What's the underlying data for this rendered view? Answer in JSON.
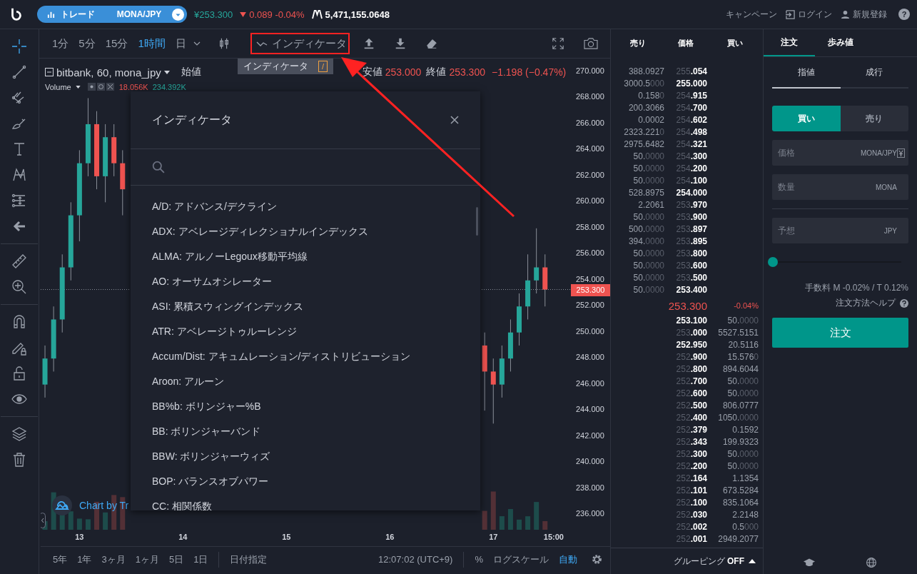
{
  "topbar": {
    "mode": "トレード",
    "pair": "MONA/JPY",
    "price": "¥253.300",
    "change": "0.089 -0.04%",
    "volume": "5,471,155.0648",
    "links": [
      {
        "kind": "text",
        "label": "キャンペーン"
      },
      {
        "kind": "login",
        "label": "ログイン"
      },
      {
        "kind": "user",
        "label": "新規登録"
      },
      {
        "kind": "help",
        "label": "?"
      }
    ]
  },
  "tool_groups": [
    [
      {
        "kind": "crosshair",
        "selected": true
      },
      {
        "kind": "line",
        "selected": false
      },
      {
        "kind": "fork",
        "selected": false
      },
      {
        "kind": "brush",
        "selected": false
      },
      {
        "kind": "text",
        "selected": false
      },
      {
        "kind": "pattern",
        "selected": false
      },
      {
        "kind": "measure",
        "selected": false
      },
      {
        "kind": "back",
        "selected": false
      }
    ],
    [
      {
        "kind": "ruler",
        "selected": false
      },
      {
        "kind": "zoom",
        "selected": false
      }
    ],
    [
      {
        "kind": "magnet",
        "selected": false
      },
      {
        "kind": "pencil-lock",
        "selected": false
      },
      {
        "kind": "lock",
        "selected": false
      },
      {
        "kind": "eye",
        "selected": false
      }
    ],
    [
      {
        "kind": "layers",
        "selected": false
      },
      {
        "kind": "trash",
        "selected": false
      }
    ]
  ],
  "toolbar": {
    "intervals": [
      {
        "label": "1分",
        "selected": false
      },
      {
        "label": "5分",
        "selected": false
      },
      {
        "label": "15分",
        "selected": false
      },
      {
        "label": "1時間",
        "selected": true
      },
      {
        "label": "日",
        "selected": false
      }
    ],
    "indicator_button": {
      "label": "インディケータ",
      "highlighted": true
    },
    "tooltip": {
      "label": "インディケータ",
      "key": "/"
    },
    "annotation_arrow": true
  },
  "legend": {
    "symbol": "bitbank, 60, mona_jpy",
    "ohlc": [
      {
        "label": "始値"
      },
      {
        "label": "安値",
        "value": "253.000"
      },
      {
        "label": "終値",
        "value": "253.300"
      }
    ],
    "change": "−1.198 (−0.47%)",
    "volume_label": "Volume",
    "volume_down": "18.056K",
    "volume_up": "234.392K",
    "attribution": "Chart by Tr"
  },
  "chart": {
    "last_price_tag": "253.300",
    "chart_data": {
      "type": "candlestick",
      "categories": [
        null,
        null,
        null,
        null,
        "13",
        null,
        null,
        null,
        null,
        null,
        null,
        null,
        null,
        null,
        null,
        null,
        "14",
        null,
        null,
        null,
        null,
        null,
        null,
        null,
        null,
        null,
        null,
        null,
        "15",
        null,
        null,
        null,
        null,
        null,
        null,
        null,
        null,
        null,
        null,
        null,
        "16",
        null,
        null,
        null,
        null,
        null,
        null,
        null,
        null,
        null,
        null,
        null,
        "17",
        null,
        null,
        null,
        null,
        null,
        null,
        "15:00"
      ],
      "ohlc": [
        [
          246,
          249,
          245,
          248
        ],
        [
          248,
          252,
          247,
          251
        ],
        [
          251,
          256,
          250,
          255
        ],
        [
          255,
          260,
          254,
          259
        ],
        [
          259,
          264,
          257,
          263
        ],
        [
          263,
          268,
          262,
          266
        ],
        [
          266,
          267,
          261,
          262
        ],
        [
          262,
          266,
          260,
          265
        ],
        [
          265,
          266,
          262,
          263
        ],
        [
          263,
          264,
          259,
          261
        ],
        null,
        null,
        null,
        null,
        null,
        null,
        null,
        null,
        null,
        null,
        null,
        null,
        null,
        null,
        null,
        null,
        null,
        null,
        null,
        null,
        null,
        null,
        null,
        null,
        null,
        null,
        null,
        null,
        null,
        null,
        null,
        null,
        null,
        null,
        null,
        null,
        null,
        null,
        null,
        null,
        null,
        [
          249,
          250,
          244,
          247
        ],
        [
          247,
          248,
          243,
          246
        ],
        [
          246,
          249,
          245,
          248
        ],
        [
          248,
          251,
          247,
          250
        ],
        [
          250,
          253,
          249,
          252
        ],
        [
          252,
          256,
          251,
          254
        ],
        [
          254,
          258,
          253,
          255
        ],
        [
          255,
          256,
          252,
          253.3
        ],
        null
      ],
      "ref_lines": [
        {
          "axis": "y",
          "value": 253.3
        }
      ],
      "ylim": [
        236,
        270
      ],
      "yticks": [
        {
          "value": 270,
          "label": "270.000"
        },
        {
          "value": 268,
          "label": "268.000"
        },
        {
          "value": 266,
          "label": "266.000"
        },
        {
          "value": 264,
          "label": "264.000"
        },
        {
          "value": 262,
          "label": "262.000"
        },
        {
          "value": 260,
          "label": "260.000"
        },
        {
          "value": 258,
          "label": "258.000"
        },
        {
          "value": 256,
          "label": "256.000"
        },
        {
          "value": 254,
          "label": "254.000"
        },
        {
          "value": 252,
          "label": "252.000"
        },
        {
          "value": 250,
          "label": "250.000"
        },
        {
          "value": 248,
          "label": "248.000"
        },
        {
          "value": 246,
          "label": "246.000"
        },
        {
          "value": 244,
          "label": "244.000"
        },
        {
          "value": 242,
          "label": "242.000"
        },
        {
          "value": 240,
          "label": "240.000"
        },
        {
          "value": 238,
          "label": "238.000"
        },
        {
          "value": 236,
          "label": "236.000"
        }
      ]
    }
  },
  "indicator_dialog": {
    "title": "インディケータ",
    "items": [
      "A/D: アドバンス/デクライン",
      "ADX: アベレージディレクショナルインデックス",
      "ALMA: アルノーLegoux移動平均線",
      "AO: オーサムオシレーター",
      "ASI: 累積スウィングインデックス",
      "ATR: アベレージトゥルーレンジ",
      "Accum/Dist: アキュムレーション/ディストリビューション",
      "Aroon: アルーン",
      "BB%b: ボリンジャー%B",
      "BB: ボリンジャーバンド",
      "BBW: ボリンジャーウィズ",
      "BOP: バランスオブパワー",
      "CC: 相関係数"
    ]
  },
  "bottom_bar": {
    "ranges": [
      "5年",
      "1年",
      "3ヶ月",
      "1ヶ月",
      "5日",
      "1日"
    ],
    "date_button": "日付指定",
    "clock": "12:07:02 (UTC+9)",
    "options": [
      {
        "label": "%",
        "selected": false
      },
      {
        "label": "ログスケール",
        "selected": false
      },
      {
        "label": "自動",
        "selected": true
      }
    ]
  },
  "orderbook": {
    "columns": [
      "売り",
      "価格",
      "買い"
    ],
    "asks": [
      {
        "amount": "388.0927",
        "price": "255.054",
        "emphasized": false
      },
      {
        "amount": "3000.5000",
        "price": "255.000",
        "emphasized": true
      },
      {
        "amount": "0.1580",
        "price": "254.915",
        "emphasized": false
      },
      {
        "amount": "200.3066",
        "price": "254.700",
        "emphasized": false
      },
      {
        "amount": "0.0002",
        "price": "254.602",
        "emphasized": false
      },
      {
        "amount": "2323.2210",
        "price": "254.498",
        "emphasized": false
      },
      {
        "amount": "2975.6482",
        "price": "254.321",
        "emphasized": false
      },
      {
        "amount": "50.0000",
        "price": "254.300",
        "emphasized": false
      },
      {
        "amount": "50.0000",
        "price": "254.200",
        "emphasized": false
      },
      {
        "amount": "50.0000",
        "price": "254.100",
        "emphasized": false
      },
      {
        "amount": "528.8975",
        "price": "254.000",
        "emphasized": true
      },
      {
        "amount": "2.2061",
        "price": "253.970",
        "emphasized": false
      },
      {
        "amount": "50.0000",
        "price": "253.900",
        "emphasized": false
      },
      {
        "amount": "500.0000",
        "price": "253.897",
        "emphasized": false
      },
      {
        "amount": "394.0000",
        "price": "253.895",
        "emphasized": false
      },
      {
        "amount": "50.0000",
        "price": "253.800",
        "emphasized": false
      },
      {
        "amount": "50.0000",
        "price": "253.600",
        "emphasized": false
      },
      {
        "amount": "50.0000",
        "price": "253.500",
        "emphasized": false
      },
      {
        "amount": "50.0000",
        "price": "253.400",
        "emphasized": true
      }
    ],
    "last": "253.300",
    "last_change": "-0.04%",
    "bids": [
      {
        "price": "253.100",
        "amount": "50.0000",
        "emphasized": true
      },
      {
        "price": "253.000",
        "amount": "5527.5151",
        "emphasized": false
      },
      {
        "price": "252.950",
        "amount": "20.5116",
        "emphasized": true
      },
      {
        "price": "252.900",
        "amount": "15.5760",
        "emphasized": false
      },
      {
        "price": "252.800",
        "amount": "894.6044",
        "emphasized": false
      },
      {
        "price": "252.700",
        "amount": "50.0000",
        "emphasized": false
      },
      {
        "price": "252.600",
        "amount": "50.0000",
        "emphasized": false
      },
      {
        "price": "252.500",
        "amount": "806.0777",
        "emphasized": false
      },
      {
        "price": "252.400",
        "amount": "1050.0000",
        "emphasized": false
      },
      {
        "price": "252.379",
        "amount": "0.1592",
        "emphasized": false
      },
      {
        "price": "252.343",
        "amount": "199.9323",
        "emphasized": false
      },
      {
        "price": "252.300",
        "amount": "50.0000",
        "emphasized": false
      },
      {
        "price": "252.200",
        "amount": "50.0000",
        "emphasized": false
      },
      {
        "price": "252.164",
        "amount": "1.1354",
        "emphasized": false
      },
      {
        "price": "252.101",
        "amount": "673.5284",
        "emphasized": false
      },
      {
        "price": "252.100",
        "amount": "835.1064",
        "emphasized": false
      },
      {
        "price": "252.030",
        "amount": "2.2148",
        "emphasized": false
      },
      {
        "price": "252.002",
        "amount": "0.5000",
        "emphasized": false
      },
      {
        "price": "252.001",
        "amount": "2949.2077",
        "emphasized": false
      }
    ],
    "grouping_label": "グルーピング",
    "grouping_value": "OFF"
  },
  "order_panel": {
    "tabs": [
      {
        "label": "注文",
        "selected": true
      },
      {
        "label": "歩み値",
        "selected": false
      }
    ],
    "order_types": [
      {
        "label": "指値",
        "selected": true
      },
      {
        "label": "成行",
        "selected": false
      }
    ],
    "sides": [
      {
        "label": "買い",
        "selected": true
      },
      {
        "label": "売り",
        "selected": false
      }
    ],
    "fields": [
      {
        "label": "価格",
        "unit": "MONA/JPY",
        "kind": "price"
      },
      {
        "label": "数量",
        "unit": "MONA",
        "kind": "plain"
      },
      {
        "label": "予想",
        "unit": "JPY",
        "kind": "estimate"
      }
    ],
    "slider": {
      "level": 0
    },
    "fee": "手数料 M -0.02% / T 0.12%",
    "help": "注文方法ヘルプ",
    "submit": "注文"
  }
}
